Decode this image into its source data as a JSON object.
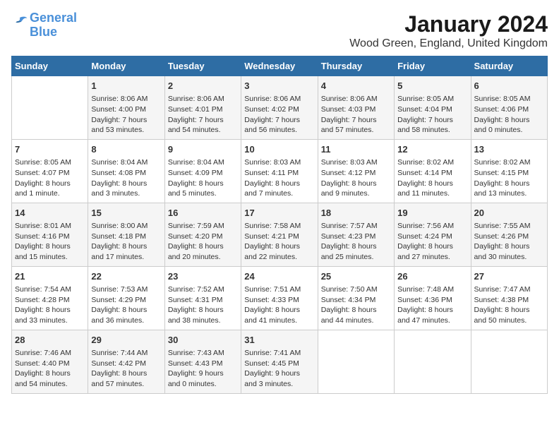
{
  "logo": {
    "line1": "General",
    "line2": "Blue"
  },
  "title": "January 2024",
  "subtitle": "Wood Green, England, United Kingdom",
  "days_header": [
    "Sunday",
    "Monday",
    "Tuesday",
    "Wednesday",
    "Thursday",
    "Friday",
    "Saturday"
  ],
  "weeks": [
    [
      {
        "day": "",
        "info": ""
      },
      {
        "day": "1",
        "info": "Sunrise: 8:06 AM\nSunset: 4:00 PM\nDaylight: 7 hours\nand 53 minutes."
      },
      {
        "day": "2",
        "info": "Sunrise: 8:06 AM\nSunset: 4:01 PM\nDaylight: 7 hours\nand 54 minutes."
      },
      {
        "day": "3",
        "info": "Sunrise: 8:06 AM\nSunset: 4:02 PM\nDaylight: 7 hours\nand 56 minutes."
      },
      {
        "day": "4",
        "info": "Sunrise: 8:06 AM\nSunset: 4:03 PM\nDaylight: 7 hours\nand 57 minutes."
      },
      {
        "day": "5",
        "info": "Sunrise: 8:05 AM\nSunset: 4:04 PM\nDaylight: 7 hours\nand 58 minutes."
      },
      {
        "day": "6",
        "info": "Sunrise: 8:05 AM\nSunset: 4:06 PM\nDaylight: 8 hours\nand 0 minutes."
      }
    ],
    [
      {
        "day": "7",
        "info": "Sunrise: 8:05 AM\nSunset: 4:07 PM\nDaylight: 8 hours\nand 1 minute."
      },
      {
        "day": "8",
        "info": "Sunrise: 8:04 AM\nSunset: 4:08 PM\nDaylight: 8 hours\nand 3 minutes."
      },
      {
        "day": "9",
        "info": "Sunrise: 8:04 AM\nSunset: 4:09 PM\nDaylight: 8 hours\nand 5 minutes."
      },
      {
        "day": "10",
        "info": "Sunrise: 8:03 AM\nSunset: 4:11 PM\nDaylight: 8 hours\nand 7 minutes."
      },
      {
        "day": "11",
        "info": "Sunrise: 8:03 AM\nSunset: 4:12 PM\nDaylight: 8 hours\nand 9 minutes."
      },
      {
        "day": "12",
        "info": "Sunrise: 8:02 AM\nSunset: 4:14 PM\nDaylight: 8 hours\nand 11 minutes."
      },
      {
        "day": "13",
        "info": "Sunrise: 8:02 AM\nSunset: 4:15 PM\nDaylight: 8 hours\nand 13 minutes."
      }
    ],
    [
      {
        "day": "14",
        "info": "Sunrise: 8:01 AM\nSunset: 4:16 PM\nDaylight: 8 hours\nand 15 minutes."
      },
      {
        "day": "15",
        "info": "Sunrise: 8:00 AM\nSunset: 4:18 PM\nDaylight: 8 hours\nand 17 minutes."
      },
      {
        "day": "16",
        "info": "Sunrise: 7:59 AM\nSunset: 4:20 PM\nDaylight: 8 hours\nand 20 minutes."
      },
      {
        "day": "17",
        "info": "Sunrise: 7:58 AM\nSunset: 4:21 PM\nDaylight: 8 hours\nand 22 minutes."
      },
      {
        "day": "18",
        "info": "Sunrise: 7:57 AM\nSunset: 4:23 PM\nDaylight: 8 hours\nand 25 minutes."
      },
      {
        "day": "19",
        "info": "Sunrise: 7:56 AM\nSunset: 4:24 PM\nDaylight: 8 hours\nand 27 minutes."
      },
      {
        "day": "20",
        "info": "Sunrise: 7:55 AM\nSunset: 4:26 PM\nDaylight: 8 hours\nand 30 minutes."
      }
    ],
    [
      {
        "day": "21",
        "info": "Sunrise: 7:54 AM\nSunset: 4:28 PM\nDaylight: 8 hours\nand 33 minutes."
      },
      {
        "day": "22",
        "info": "Sunrise: 7:53 AM\nSunset: 4:29 PM\nDaylight: 8 hours\nand 36 minutes."
      },
      {
        "day": "23",
        "info": "Sunrise: 7:52 AM\nSunset: 4:31 PM\nDaylight: 8 hours\nand 38 minutes."
      },
      {
        "day": "24",
        "info": "Sunrise: 7:51 AM\nSunset: 4:33 PM\nDaylight: 8 hours\nand 41 minutes."
      },
      {
        "day": "25",
        "info": "Sunrise: 7:50 AM\nSunset: 4:34 PM\nDaylight: 8 hours\nand 44 minutes."
      },
      {
        "day": "26",
        "info": "Sunrise: 7:48 AM\nSunset: 4:36 PM\nDaylight: 8 hours\nand 47 minutes."
      },
      {
        "day": "27",
        "info": "Sunrise: 7:47 AM\nSunset: 4:38 PM\nDaylight: 8 hours\nand 50 minutes."
      }
    ],
    [
      {
        "day": "28",
        "info": "Sunrise: 7:46 AM\nSunset: 4:40 PM\nDaylight: 8 hours\nand 54 minutes."
      },
      {
        "day": "29",
        "info": "Sunrise: 7:44 AM\nSunset: 4:42 PM\nDaylight: 8 hours\nand 57 minutes."
      },
      {
        "day": "30",
        "info": "Sunrise: 7:43 AM\nSunset: 4:43 PM\nDaylight: 9 hours\nand 0 minutes."
      },
      {
        "day": "31",
        "info": "Sunrise: 7:41 AM\nSunset: 4:45 PM\nDaylight: 9 hours\nand 3 minutes."
      },
      {
        "day": "",
        "info": ""
      },
      {
        "day": "",
        "info": ""
      },
      {
        "day": "",
        "info": ""
      }
    ]
  ]
}
